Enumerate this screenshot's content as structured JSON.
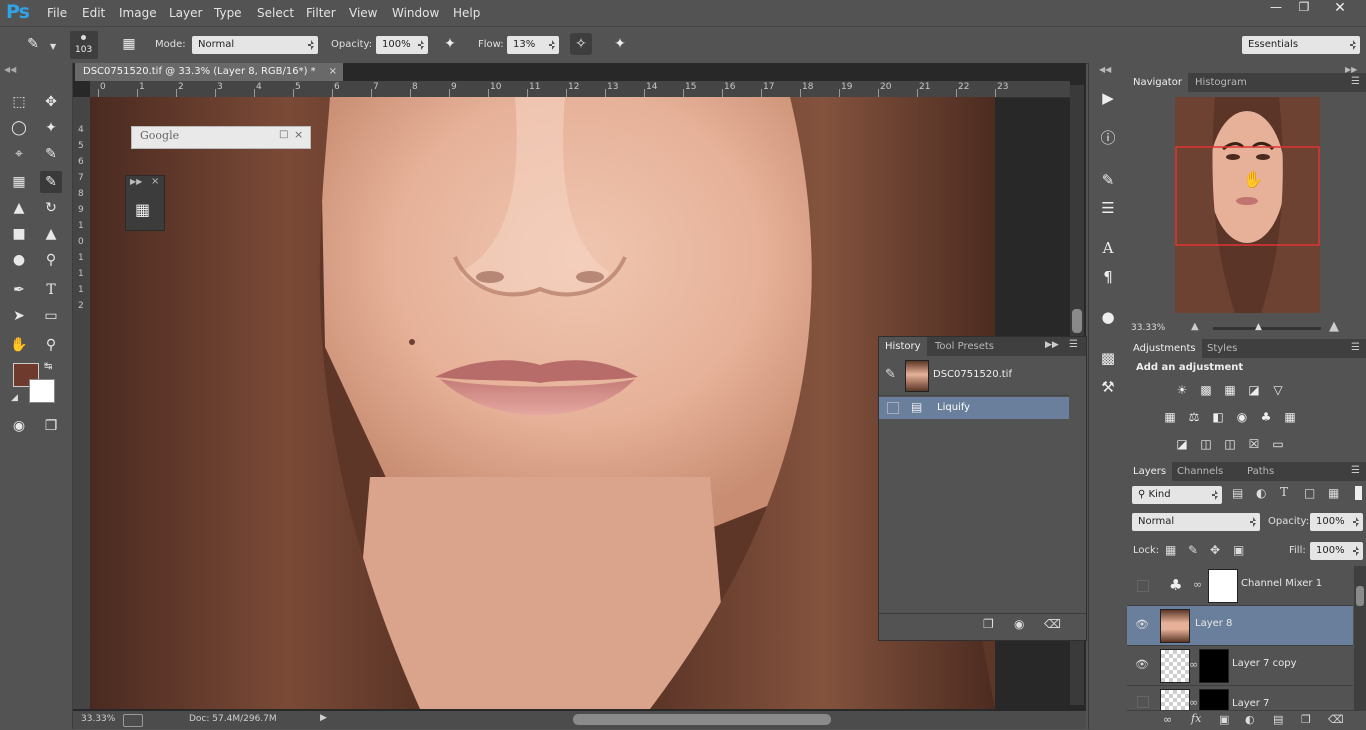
{
  "menubar": {
    "logo": "Ps",
    "items": [
      "File",
      "Edit",
      "Image",
      "Layer",
      "Type",
      "Select",
      "Filter",
      "View",
      "Window",
      "Help"
    ]
  },
  "options": {
    "brush_size": "103",
    "mode_label": "Mode:",
    "mode_value": "Normal",
    "opacity_label": "Opacity:",
    "opacity_value": "100%",
    "flow_label": "Flow:",
    "flow_value": "13%",
    "workspace": "Essentials"
  },
  "document": {
    "tab_title": "DSC0751520.tif @ 33.3% (Layer 8, RGB/16*) *",
    "ruler_h": [
      "0",
      "1",
      "2",
      "3",
      "4",
      "5",
      "6",
      "7",
      "8",
      "9",
      "10",
      "11",
      "12",
      "13",
      "14",
      "15",
      "16",
      "17",
      "18",
      "19",
      "20",
      "21",
      "22",
      "23"
    ],
    "ruler_v": [
      "4",
      "5",
      "6",
      "7",
      "8",
      "9",
      "1",
      "0",
      "1",
      "1",
      "1",
      "2"
    ],
    "zoom": "33.33%",
    "doc_size": "Doc: 57.4M/296.7M"
  },
  "google_panel": {
    "title": "Google"
  },
  "history": {
    "tabs": [
      "History",
      "Tool Presets"
    ],
    "items": [
      {
        "label": "DSC0751520.tif",
        "selected": false
      },
      {
        "label": "Liquify",
        "selected": true
      }
    ]
  },
  "navigator": {
    "tabs": [
      "Navigator",
      "Histogram"
    ],
    "zoom": "33.33%"
  },
  "adjustments": {
    "tabs": [
      "Adjustments",
      "Styles"
    ],
    "heading": "Add an adjustment"
  },
  "layers": {
    "tabs": [
      "Layers",
      "Channels",
      "Paths"
    ],
    "filter_kind": "Kind",
    "blend_mode": "Normal",
    "opacity_label": "Opacity:",
    "opacity_value": "100%",
    "lock_label": "Lock:",
    "fill_label": "Fill:",
    "fill_value": "100%",
    "items": [
      {
        "name": "Channel Mixer 1",
        "visible": false,
        "selected": false
      },
      {
        "name": "Layer 8",
        "visible": true,
        "selected": true
      },
      {
        "name": "Layer 7 copy",
        "visible": true,
        "selected": false
      },
      {
        "name": "Layer 7",
        "visible": false,
        "selected": false
      }
    ]
  },
  "colors": {
    "foreground": "#6e3a2e",
    "background": "#ffffff",
    "selection_blue": "#6a7f9c",
    "nav_frame": "#e03535"
  }
}
